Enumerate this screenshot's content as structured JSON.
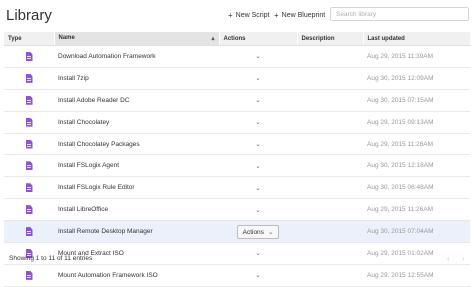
{
  "page": {
    "title": "Library"
  },
  "header": {
    "new_script_label": "New Script",
    "new_blueprint_label": "New Blueprint",
    "search_placeholder": "Search library",
    "plus_glyph": "+"
  },
  "table": {
    "columns": [
      "Type",
      "Name",
      "Actions",
      "Description",
      "Last updated"
    ],
    "sorted_column": "Name",
    "rows": [
      {
        "icon": "script-icon",
        "name": "Download Automation Framework",
        "description": "",
        "updated": "Aug 29, 2015 11:39AM"
      },
      {
        "icon": "script-icon",
        "name": "Install 7zip",
        "description": "",
        "updated": "Aug 30, 2015 12:09AM"
      },
      {
        "icon": "script-icon",
        "name": "Install Adobe Reader DC",
        "description": "",
        "updated": "Aug 30, 2015 07:15AM"
      },
      {
        "icon": "script-icon",
        "name": "Install Chocolatey",
        "description": "",
        "updated": "Aug 29, 2015 09:13AM"
      },
      {
        "icon": "script-icon",
        "name": "Install Chocolatey Packages",
        "description": "",
        "updated": "Aug 29, 2015 11:26AM"
      },
      {
        "icon": "script-icon",
        "name": "Install FSLogix Agent",
        "description": "",
        "updated": "Aug 30, 2015 12:18AM"
      },
      {
        "icon": "script-icon",
        "name": "Install FSLogix Rule Editor",
        "description": "",
        "updated": "Aug 30, 2015 06:48AM"
      },
      {
        "icon": "script-icon",
        "name": "Install LibreOffice",
        "description": "",
        "updated": "Aug 29, 2015 11:26AM"
      },
      {
        "icon": "script-icon",
        "name": "Install Remote Desktop Manager",
        "description": "",
        "updated": "Aug 30, 2015 07:04AM",
        "selected": true
      },
      {
        "icon": "script-icon",
        "name": "Mount and Extract ISO",
        "description": "",
        "updated": "Aug 29, 2015 01:02AM"
      },
      {
        "icon": "script-icon",
        "name": "Mount Automation Framework ISO",
        "description": "",
        "updated": "Aug 29, 2015 12:55AM"
      }
    ],
    "actions_label": "Actions",
    "chevron_glyph": "⌄",
    "sort_glyph": "▴"
  },
  "footer": {
    "info": "Showing 1 to 11 of 11 entries",
    "prev_glyph": "‹",
    "next_glyph": "›"
  },
  "colors": {
    "icon": "#8d55d0",
    "selected_row": "#eaf1fa",
    "header_bg": "#f0f0f0",
    "date_text": "#999999"
  }
}
